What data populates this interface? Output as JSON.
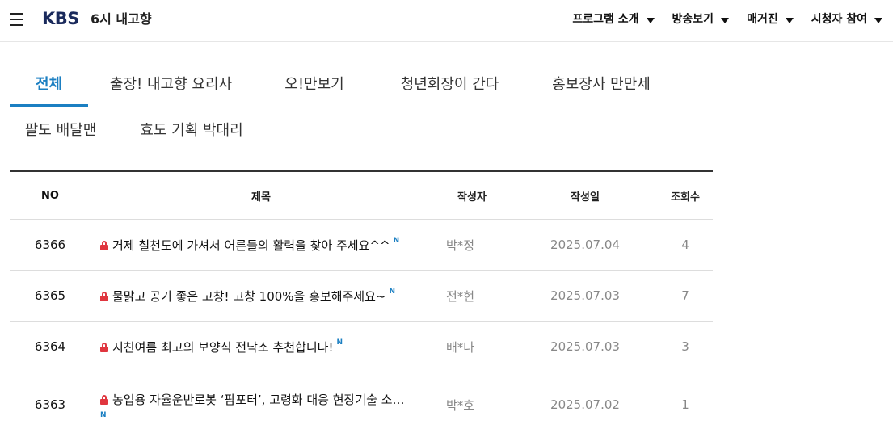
{
  "header": {
    "logo": "KBS",
    "program_title": "6시 내고향",
    "nav": [
      {
        "label": "프로그램 소개"
      },
      {
        "label": "방송보기"
      },
      {
        "label": "매거진"
      },
      {
        "label": "시청자 참여"
      }
    ]
  },
  "tabs": {
    "row1": [
      {
        "label": "전체",
        "active": true
      },
      {
        "label": "출장! 내고향 요리사"
      },
      {
        "label": "오!만보기"
      },
      {
        "label": "청년회장이 간다"
      },
      {
        "label": "홍보장사 만만세"
      }
    ],
    "row2": [
      {
        "label": "팔도 배달맨"
      },
      {
        "label": "효도 기획 박대리"
      }
    ]
  },
  "table": {
    "headers": {
      "no": "NO",
      "title": "제목",
      "author": "작성자",
      "date": "작성일",
      "views": "조회수"
    },
    "rows": [
      {
        "no": "6366",
        "title": "거제 칠천도에 가셔서 어른들의 활력을 찾아 주세요^^",
        "badge": "N",
        "author": "박*정",
        "date": "2025.07.04",
        "views": "4"
      },
      {
        "no": "6365",
        "title": "물맑고 공기 좋은 고창! 고창 100%을 홍보해주세요~",
        "badge": "N",
        "author": "전*현",
        "date": "2025.07.03",
        "views": "7"
      },
      {
        "no": "6364",
        "title": "지친여름 최고의 보양식 전낙소 추천합니다!",
        "badge": "N",
        "author": "배*나",
        "date": "2025.07.03",
        "views": "3"
      },
      {
        "no": "6363",
        "title": "농업용 자율운반로봇 ‘팜포터’, 고령화 대응 현장기술 소…",
        "badge": "N",
        "author": "박*호",
        "date": "2025.07.02",
        "views": "1"
      }
    ]
  },
  "colors": {
    "accent": "#1b7fc2",
    "lock": "#e0363f",
    "logo": "#1a2a5c"
  },
  "icons": {
    "menu": "hamburger-menu-icon",
    "lock": "lock-icon",
    "caret": "caret-down-icon"
  }
}
